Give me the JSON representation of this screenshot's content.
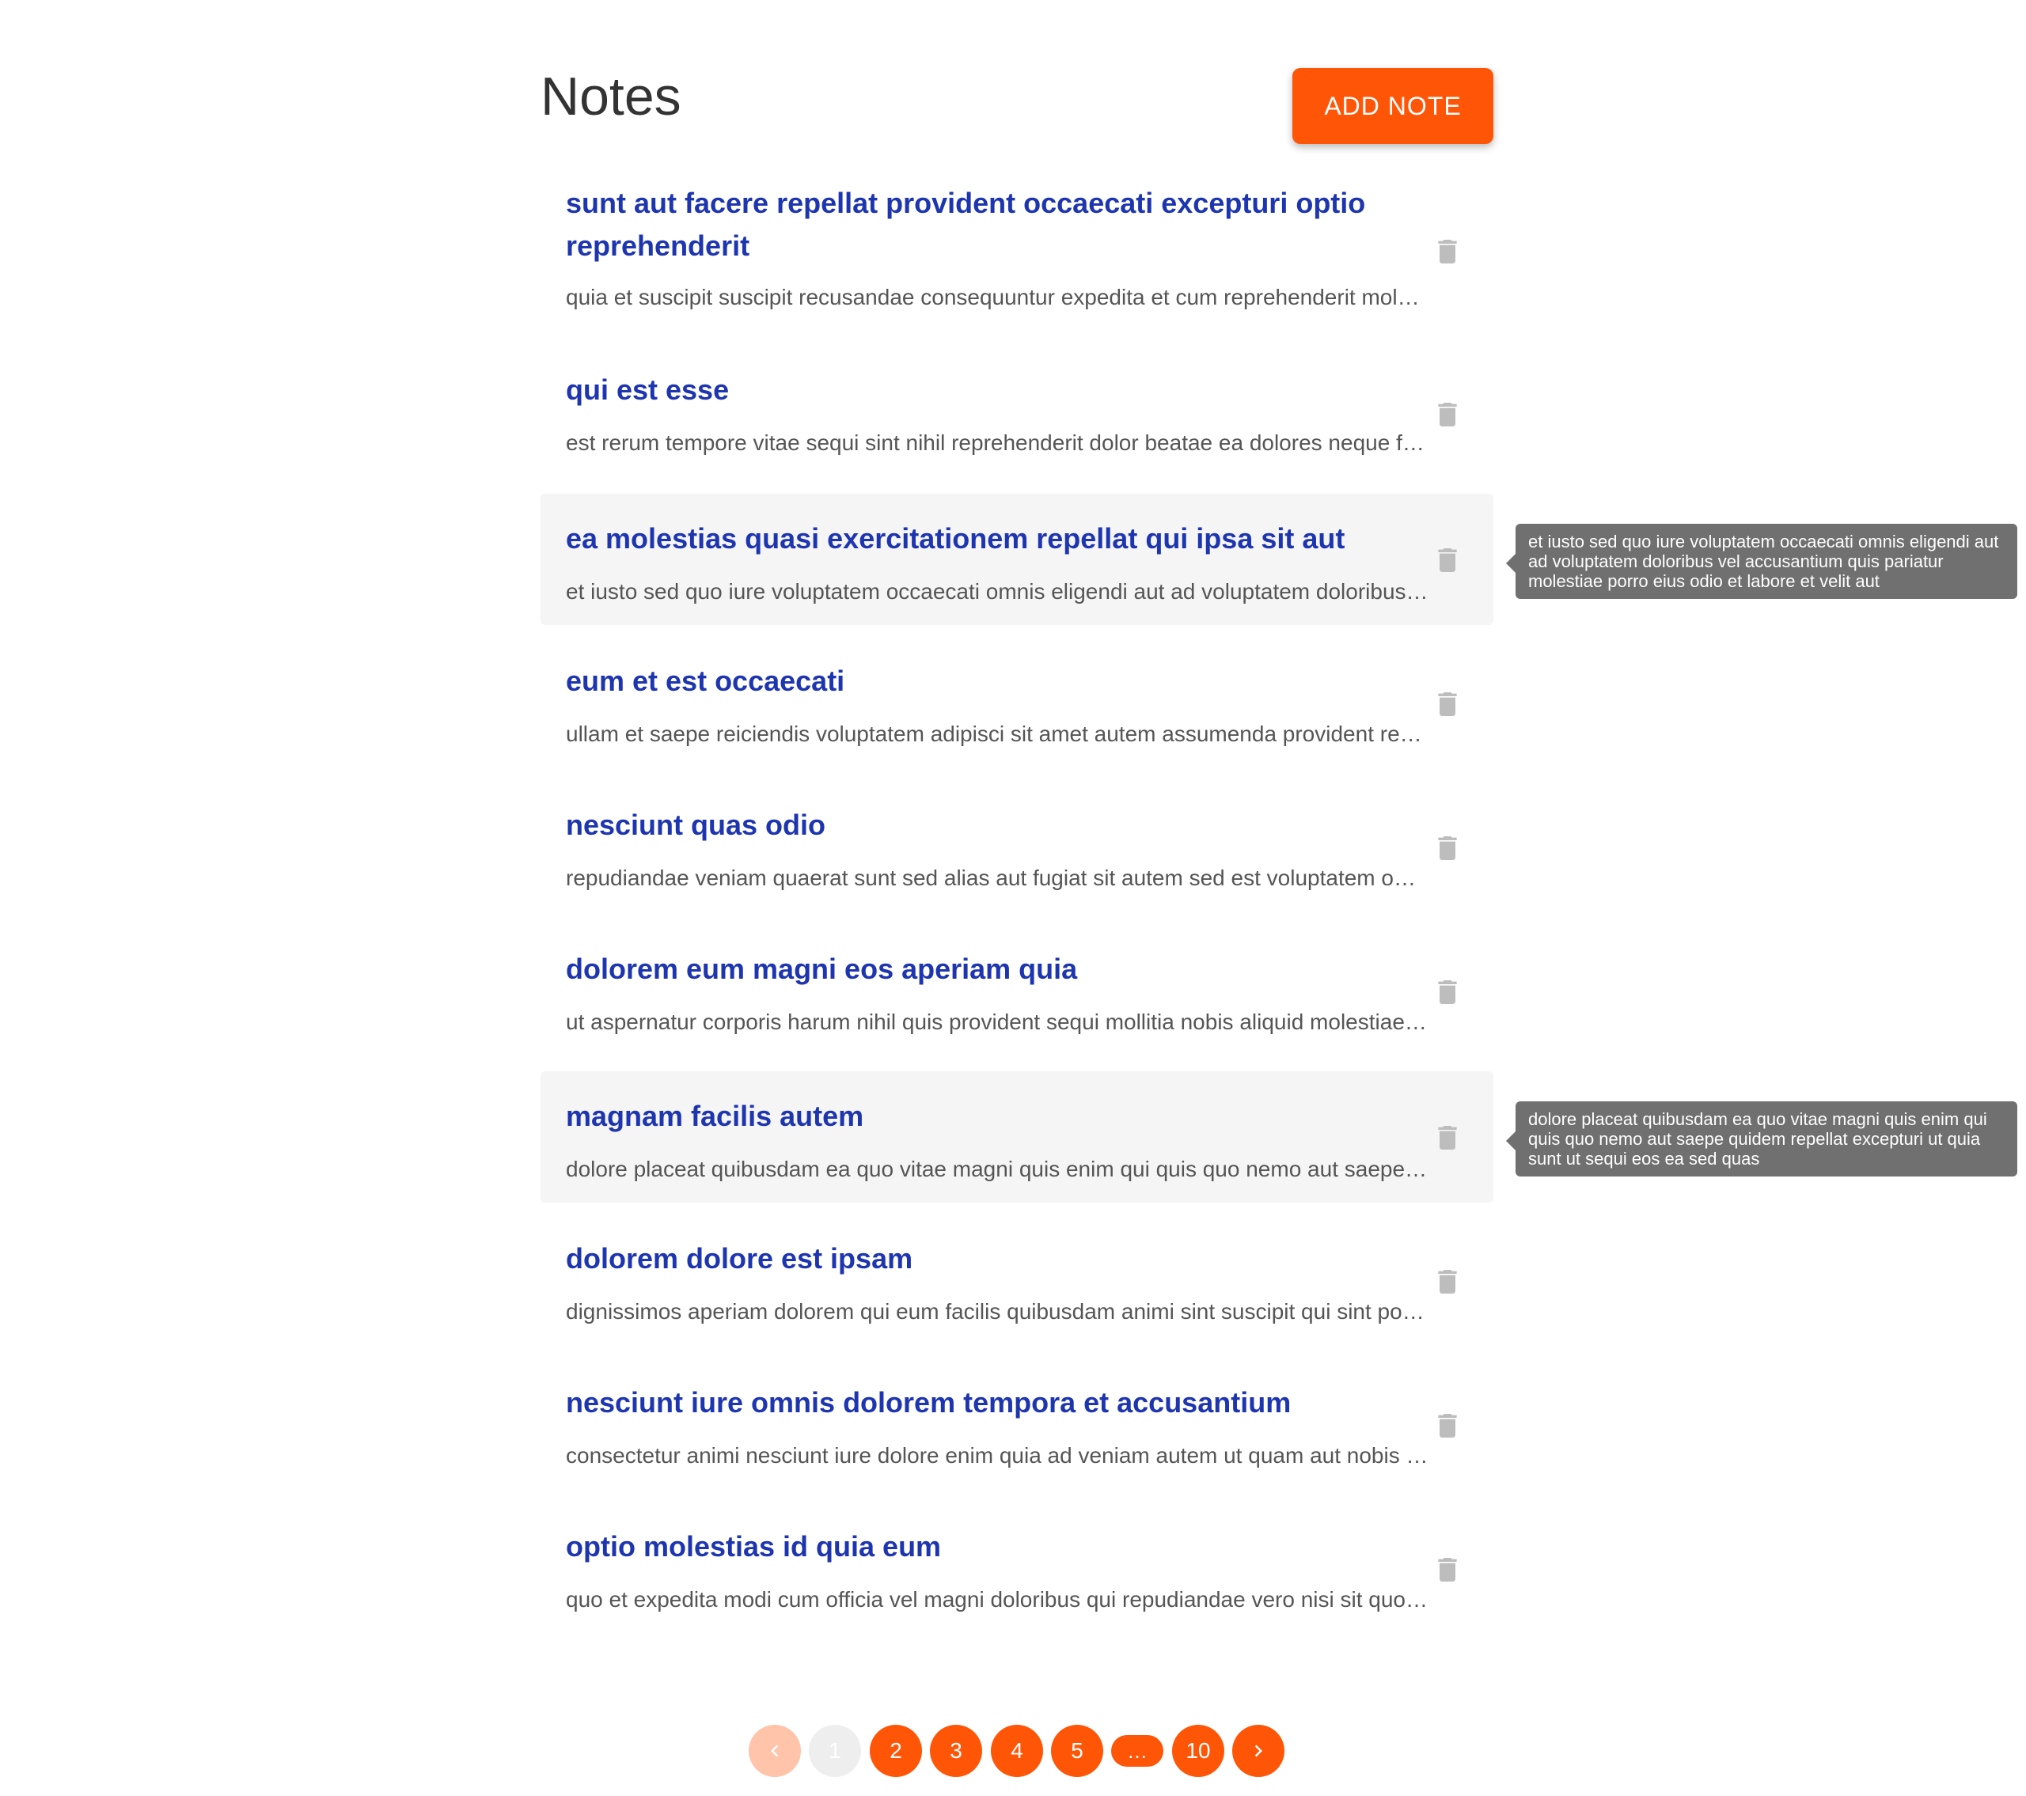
{
  "header": {
    "title": "Notes",
    "add_button_label": "ADD NOTE"
  },
  "notes": [
    {
      "title": "sunt aut facere repellat provident occaecati excepturi optio reprehenderit",
      "body": "quia et suscipit suscipit recusandae consequuntur expedita et cum reprehenderit molestiae ut ut quas totam nostrum rerum est autem sunt rem eveniet architecto"
    },
    {
      "title": "qui est esse",
      "body": "est rerum tempore vitae sequi sint nihil reprehenderit dolor beatae ea dolores neque fugiat blanditiis voluptate porro vel nihil molestiae ut reiciendis qui aperiam non debitis possimus qui neque nisi nulla"
    },
    {
      "title": "ea molestias quasi exercitationem repellat qui ipsa sit aut",
      "body": "et iusto sed quo iure voluptatem occaecati omnis eligendi aut ad voluptatem doloribus vel accusantium quis pariatur molestiae porro eius odio et labore et velit aut"
    },
    {
      "title": "eum et est occaecati",
      "body": "ullam et saepe reiciendis voluptatem adipisci sit amet autem assumenda provident rerum culpa quis hic commodi nesciunt rem tenetur doloremque ipsam iure quis sunt voluptatem rerum illo velit"
    },
    {
      "title": "nesciunt quas odio",
      "body": "repudiandae veniam quaerat sunt sed alias aut fugiat sit autem sed est voluptatem omnis possimus esse voluptatibus quis est aut tenetur dolor neque"
    },
    {
      "title": "dolorem eum magni eos aperiam quia",
      "body": "ut aspernatur corporis harum nihil quis provident sequi mollitia nobis aliquid molestiae perspiciatis et ea nemo ab reprehenderit accusantium quas voluptate dolores velit et doloremque molestiae"
    },
    {
      "title": "magnam facilis autem",
      "body": "dolore placeat quibusdam ea quo vitae magni quis enim qui quis quo nemo aut saepe quidem repellat excepturi ut quia sunt ut sequi eos ea sed quas"
    },
    {
      "title": "dolorem dolore est ipsam",
      "body": "dignissimos aperiam dolorem qui eum facilis quibusdam animi sint suscipit qui sint possimus cum quaerat magni maiores excepturi ipsam ut commodi dolor voluptatum modi aut vitae"
    },
    {
      "title": "nesciunt iure omnis dolorem tempora et accusantium",
      "body": "consectetur animi nesciunt iure dolore enim quia ad veniam autem ut quam aut nobis et est aut quod aut provident voluptas autem voluptas"
    },
    {
      "title": "optio molestias id quia eum",
      "body": "quo et expedita modi cum officia vel magni doloribus qui repudiandae vero nisi sit quos veniam quod sed accusamus veritatis error"
    }
  ],
  "tooltips": [
    {
      "text": "et iusto sed quo iure voluptatem occaecati omnis eligendi aut ad voluptatem doloribus vel accusantium quis pariatur molestiae porro eius odio et labore et velit aut"
    },
    {
      "text": "dolore placeat quibusdam ea quo vitae magni quis enim qui quis quo nemo aut saepe quidem repellat excepturi ut quia sunt ut sequi eos ea sed quas"
    }
  ],
  "pagination": {
    "prev_icon": "chevron-left-icon",
    "next_icon": "chevron-right-icon",
    "current_page": "1",
    "pages": [
      "1",
      "2",
      "3",
      "4",
      "5",
      "…",
      "10"
    ]
  },
  "colors": {
    "accent": "#ff5506",
    "accent_disabled": "#ffc4a9",
    "title_blue": "#1e35b0",
    "trash_gray": "#bdbdbd",
    "hover_bg": "#f5f5f5",
    "tooltip_bg": "#707070"
  },
  "icons": {
    "delete": "trash-icon"
  }
}
